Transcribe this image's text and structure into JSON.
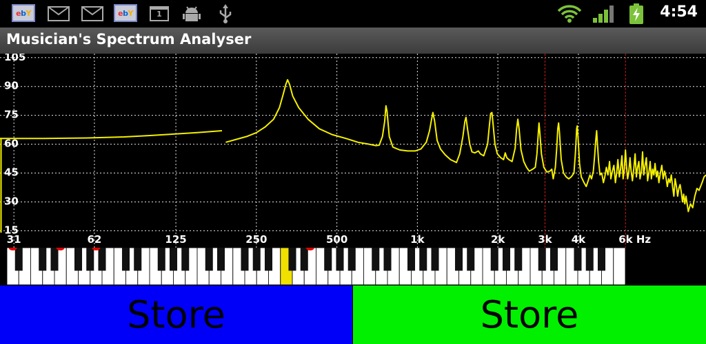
{
  "status_bar": {
    "left_icons": [
      "ebay-icon",
      "mail-icon",
      "mail-icon",
      "ebay-icon",
      "calendar-icon",
      "android-debug-icon",
      "usb-icon"
    ],
    "ebay_letters": [
      "e",
      "b",
      "Y"
    ],
    "calendar_day": "1",
    "right_icons": [
      "wifi-icon",
      "signal-icon",
      "battery-charging-icon"
    ],
    "time": "4:54"
  },
  "app": {
    "title": "Musician's Spectrum Analyser"
  },
  "chart_data": {
    "type": "line",
    "title": "",
    "xlabel": "",
    "ylabel": "",
    "x_scale": "log",
    "x_unit": "Hz",
    "xlim": [
      27.5,
      12000
    ],
    "ylim": [
      13,
      106
    ],
    "y_ticks": [
      105,
      90,
      75,
      60,
      45,
      30,
      15
    ],
    "x_ticks": [
      {
        "value": 31,
        "label": "31"
      },
      {
        "value": 62,
        "label": "62"
      },
      {
        "value": 125,
        "label": "125"
      },
      {
        "value": 250,
        "label": "250"
      },
      {
        "value": 500,
        "label": "500"
      },
      {
        "value": 1000,
        "label": "1k"
      },
      {
        "value": 2000,
        "label": "2k"
      },
      {
        "value": 3000,
        "label": "3k"
      },
      {
        "value": 4000,
        "label": "4k"
      },
      {
        "value": 6000,
        "label": "6k Hz"
      }
    ],
    "grid": true,
    "marker_lines_hz": [
      3000,
      6000
    ],
    "series": [
      {
        "color": "#f5f000",
        "segments": [
          [
            [
              27.5,
              63
            ],
            [
              40,
              63
            ],
            [
              60,
              63.3
            ],
            [
              80,
              63.8
            ],
            [
              100,
              64.5
            ],
            [
              120,
              65.2
            ],
            [
              150,
              66
            ],
            [
              186,
              67
            ]
          ],
          [
            [
              192,
              61
            ],
            [
              210,
              62.5
            ],
            [
              230,
              64
            ],
            [
              250,
              66
            ],
            [
              270,
              69
            ],
            [
              290,
              73
            ],
            [
              305,
              79
            ],
            [
              315,
              86
            ],
            [
              322,
              91
            ],
            [
              327,
              93.5
            ],
            [
              333,
              91
            ],
            [
              342,
              85
            ],
            [
              360,
              79
            ],
            [
              390,
              73
            ],
            [
              430,
              68
            ],
            [
              480,
              65
            ],
            [
              540,
              63
            ],
            [
              600,
              61
            ],
            [
              660,
              60
            ],
            [
              700,
              59.3
            ],
            [
              720,
              59.5
            ],
            [
              740,
              64
            ],
            [
              755,
              72
            ],
            [
              763,
              80
            ],
            [
              770,
              77
            ],
            [
              785,
              64
            ],
            [
              810,
              58.5
            ],
            [
              860,
              57
            ],
            [
              920,
              56.5
            ],
            [
              980,
              56.5
            ],
            [
              1030,
              57.5
            ],
            [
              1080,
              61
            ],
            [
              1110,
              67
            ],
            [
              1130,
              73
            ],
            [
              1143,
              76.5
            ],
            [
              1160,
              72
            ],
            [
              1185,
              62
            ],
            [
              1220,
              57.5
            ],
            [
              1270,
              54.5
            ],
            [
              1330,
              52
            ],
            [
              1400,
              50.5
            ],
            [
              1440,
              55
            ],
            [
              1480,
              64
            ],
            [
              1505,
              72
            ],
            [
              1520,
              74
            ],
            [
              1540,
              68
            ],
            [
              1570,
              60
            ],
            [
              1600,
              56
            ],
            [
              1640,
              55.5
            ],
            [
              1690,
              56.5
            ],
            [
              1720,
              55
            ],
            [
              1770,
              54
            ],
            [
              1830,
              60
            ],
            [
              1860,
              70
            ],
            [
              1880,
              76
            ],
            [
              1900,
              76.5
            ],
            [
              1920,
              70
            ],
            [
              1950,
              60
            ],
            [
              1990,
              55
            ],
            [
              2050,
              53
            ],
            [
              2100,
              52
            ],
            [
              2130,
              55.5
            ],
            [
              2160,
              53
            ],
            [
              2200,
              52
            ],
            [
              2260,
              51
            ],
            [
              2320,
              58
            ],
            [
              2350,
              68
            ],
            [
              2375,
              73
            ],
            [
              2400,
              68
            ],
            [
              2440,
              57
            ],
            [
              2500,
              51
            ],
            [
              2560,
              48
            ],
            [
              2620,
              46
            ],
            [
              2700,
              47
            ],
            [
              2760,
              48
            ],
            [
              2800,
              55
            ],
            [
              2830,
              65
            ],
            [
              2850,
              71
            ],
            [
              2870,
              66
            ],
            [
              2910,
              55
            ],
            [
              2970,
              48
            ],
            [
              3050,
              45.5
            ],
            [
              3130,
              46
            ],
            [
              3180,
              47
            ],
            [
              3220,
              42
            ],
            [
              3280,
              48
            ],
            [
              3320,
              58
            ],
            [
              3350,
              68
            ],
            [
              3372,
              71
            ],
            [
              3400,
              66
            ],
            [
              3450,
              52
            ],
            [
              3520,
              45
            ],
            [
              3600,
              43
            ],
            [
              3680,
              42
            ],
            [
              3760,
              43
            ],
            [
              3850,
              45
            ],
            [
              3900,
              56
            ],
            [
              3940,
              68
            ],
            [
              3960,
              69.5
            ],
            [
              3990,
              63
            ],
            [
              4040,
              50
            ],
            [
              4100,
              43
            ],
            [
              4200,
              40
            ],
            [
              4280,
              38
            ],
            [
              4350,
              41
            ],
            [
              4420,
              44
            ],
            [
              4480,
              42
            ],
            [
              4550,
              46
            ],
            [
              4600,
              54
            ],
            [
              4650,
              63
            ],
            [
              4680,
              67
            ],
            [
              4710,
              61
            ],
            [
              4760,
              51
            ],
            [
              4820,
              44
            ],
            [
              4890,
              45
            ],
            [
              4960,
              40
            ],
            [
              5020,
              43
            ],
            [
              5090,
              48
            ],
            [
              5160,
              44
            ],
            [
              5230,
              51
            ],
            [
              5290,
              42
            ],
            [
              5360,
              46
            ],
            [
              5430,
              49
            ],
            [
              5500,
              40
            ],
            [
              5560,
              45
            ],
            [
              5620,
              52
            ],
            [
              5690,
              43
            ],
            [
              5750,
              47
            ],
            [
              5820,
              54
            ],
            [
              5880,
              42
            ],
            [
              5940,
              47
            ],
            [
              6000,
              57
            ],
            [
              6050,
              49
            ],
            [
              6110,
              42
            ],
            [
              6170,
              45
            ],
            [
              6240,
              53
            ],
            [
              6300,
              46
            ],
            [
              6370,
              41
            ],
            [
              6440,
              47
            ],
            [
              6520,
              55
            ],
            [
              6590,
              43
            ],
            [
              6660,
              48
            ],
            [
              6730,
              51
            ],
            [
              6800,
              42
            ],
            [
              6880,
              46
            ],
            [
              6950,
              56
            ],
            [
              7020,
              44
            ],
            [
              7100,
              49
            ],
            [
              7180,
              53
            ],
            [
              7260,
              41
            ],
            [
              7340,
              45
            ],
            [
              7420,
              51
            ],
            [
              7500,
              42
            ],
            [
              7580,
              47
            ],
            [
              7660,
              44
            ],
            [
              7740,
              50
            ],
            [
              7830,
              43
            ],
            [
              7910,
              46
            ],
            [
              8000,
              40
            ],
            [
              8100,
              45
            ],
            [
              8200,
              49
            ],
            [
              8300,
              42
            ],
            [
              8400,
              46
            ],
            [
              8500,
              43
            ],
            [
              8600,
              38
            ],
            [
              8700,
              42
            ],
            [
              8800,
              40
            ],
            [
              8900,
              44
            ],
            [
              9000,
              38
            ],
            [
              9100,
              33
            ],
            [
              9200,
              42
            ],
            [
              9300,
              38
            ],
            [
              9400,
              33
            ],
            [
              9500,
              37
            ],
            [
              9600,
              39
            ],
            [
              9700,
              35
            ],
            [
              9800,
              30
            ],
            [
              9900,
              34
            ],
            [
              10000,
              29
            ],
            [
              10100,
              33
            ],
            [
              10300,
              25
            ],
            [
              10500,
              29
            ],
            [
              10700,
              27
            ],
            [
              10900,
              33
            ],
            [
              11100,
              37
            ],
            [
              11300,
              36
            ],
            [
              11600,
              40
            ],
            [
              11800,
              43
            ],
            [
              12000,
              44
            ]
          ]
        ]
      }
    ]
  },
  "keyboard": {
    "lowest_key_hz": 27.5,
    "white_key_count": 52,
    "highlighted_key_hz": 262,
    "highlight_color": "#f0e000",
    "marker_color": "#e00000",
    "red_marker_freqs_hz": [
      27.5,
      41,
      55,
      330
    ]
  },
  "buttons": [
    {
      "label": "Store",
      "color": "#0000f8"
    },
    {
      "label": "Store",
      "color": "#00f000"
    }
  ]
}
